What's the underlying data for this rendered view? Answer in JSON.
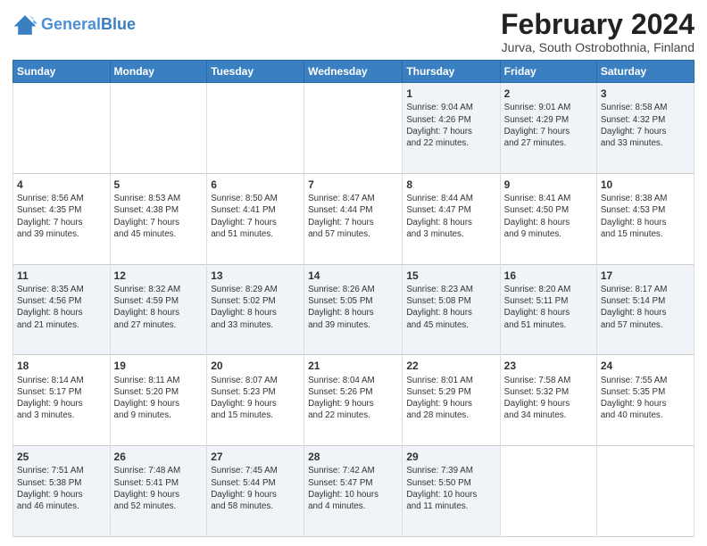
{
  "header": {
    "logo_line1": "General",
    "logo_line2": "Blue",
    "title": "February 2024",
    "subtitle": "Jurva, South Ostrobothnia, Finland"
  },
  "days_of_week": [
    "Sunday",
    "Monday",
    "Tuesday",
    "Wednesday",
    "Thursday",
    "Friday",
    "Saturday"
  ],
  "weeks": [
    [
      {
        "day": "",
        "info": ""
      },
      {
        "day": "",
        "info": ""
      },
      {
        "day": "",
        "info": ""
      },
      {
        "day": "",
        "info": ""
      },
      {
        "day": "1",
        "info": "Sunrise: 9:04 AM\nSunset: 4:26 PM\nDaylight: 7 hours\nand 22 minutes."
      },
      {
        "day": "2",
        "info": "Sunrise: 9:01 AM\nSunset: 4:29 PM\nDaylight: 7 hours\nand 27 minutes."
      },
      {
        "day": "3",
        "info": "Sunrise: 8:58 AM\nSunset: 4:32 PM\nDaylight: 7 hours\nand 33 minutes."
      }
    ],
    [
      {
        "day": "4",
        "info": "Sunrise: 8:56 AM\nSunset: 4:35 PM\nDaylight: 7 hours\nand 39 minutes."
      },
      {
        "day": "5",
        "info": "Sunrise: 8:53 AM\nSunset: 4:38 PM\nDaylight: 7 hours\nand 45 minutes."
      },
      {
        "day": "6",
        "info": "Sunrise: 8:50 AM\nSunset: 4:41 PM\nDaylight: 7 hours\nand 51 minutes."
      },
      {
        "day": "7",
        "info": "Sunrise: 8:47 AM\nSunset: 4:44 PM\nDaylight: 7 hours\nand 57 minutes."
      },
      {
        "day": "8",
        "info": "Sunrise: 8:44 AM\nSunset: 4:47 PM\nDaylight: 8 hours\nand 3 minutes."
      },
      {
        "day": "9",
        "info": "Sunrise: 8:41 AM\nSunset: 4:50 PM\nDaylight: 8 hours\nand 9 minutes."
      },
      {
        "day": "10",
        "info": "Sunrise: 8:38 AM\nSunset: 4:53 PM\nDaylight: 8 hours\nand 15 minutes."
      }
    ],
    [
      {
        "day": "11",
        "info": "Sunrise: 8:35 AM\nSunset: 4:56 PM\nDaylight: 8 hours\nand 21 minutes."
      },
      {
        "day": "12",
        "info": "Sunrise: 8:32 AM\nSunset: 4:59 PM\nDaylight: 8 hours\nand 27 minutes."
      },
      {
        "day": "13",
        "info": "Sunrise: 8:29 AM\nSunset: 5:02 PM\nDaylight: 8 hours\nand 33 minutes."
      },
      {
        "day": "14",
        "info": "Sunrise: 8:26 AM\nSunset: 5:05 PM\nDaylight: 8 hours\nand 39 minutes."
      },
      {
        "day": "15",
        "info": "Sunrise: 8:23 AM\nSunset: 5:08 PM\nDaylight: 8 hours\nand 45 minutes."
      },
      {
        "day": "16",
        "info": "Sunrise: 8:20 AM\nSunset: 5:11 PM\nDaylight: 8 hours\nand 51 minutes."
      },
      {
        "day": "17",
        "info": "Sunrise: 8:17 AM\nSunset: 5:14 PM\nDaylight: 8 hours\nand 57 minutes."
      }
    ],
    [
      {
        "day": "18",
        "info": "Sunrise: 8:14 AM\nSunset: 5:17 PM\nDaylight: 9 hours\nand 3 minutes."
      },
      {
        "day": "19",
        "info": "Sunrise: 8:11 AM\nSunset: 5:20 PM\nDaylight: 9 hours\nand 9 minutes."
      },
      {
        "day": "20",
        "info": "Sunrise: 8:07 AM\nSunset: 5:23 PM\nDaylight: 9 hours\nand 15 minutes."
      },
      {
        "day": "21",
        "info": "Sunrise: 8:04 AM\nSunset: 5:26 PM\nDaylight: 9 hours\nand 22 minutes."
      },
      {
        "day": "22",
        "info": "Sunrise: 8:01 AM\nSunset: 5:29 PM\nDaylight: 9 hours\nand 28 minutes."
      },
      {
        "day": "23",
        "info": "Sunrise: 7:58 AM\nSunset: 5:32 PM\nDaylight: 9 hours\nand 34 minutes."
      },
      {
        "day": "24",
        "info": "Sunrise: 7:55 AM\nSunset: 5:35 PM\nDaylight: 9 hours\nand 40 minutes."
      }
    ],
    [
      {
        "day": "25",
        "info": "Sunrise: 7:51 AM\nSunset: 5:38 PM\nDaylight: 9 hours\nand 46 minutes."
      },
      {
        "day": "26",
        "info": "Sunrise: 7:48 AM\nSunset: 5:41 PM\nDaylight: 9 hours\nand 52 minutes."
      },
      {
        "day": "27",
        "info": "Sunrise: 7:45 AM\nSunset: 5:44 PM\nDaylight: 9 hours\nand 58 minutes."
      },
      {
        "day": "28",
        "info": "Sunrise: 7:42 AM\nSunset: 5:47 PM\nDaylight: 10 hours\nand 4 minutes."
      },
      {
        "day": "29",
        "info": "Sunrise: 7:39 AM\nSunset: 5:50 PM\nDaylight: 10 hours\nand 11 minutes."
      },
      {
        "day": "",
        "info": ""
      },
      {
        "day": "",
        "info": ""
      }
    ]
  ]
}
